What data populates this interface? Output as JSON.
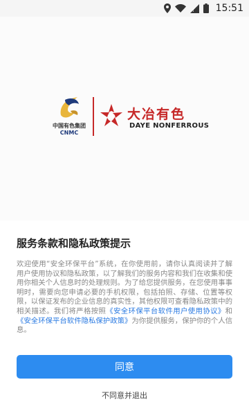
{
  "status_bar": {
    "time": "15:51",
    "icons": [
      "location-icon",
      "wifi-icon",
      "cellular-signal-icon",
      "battery-icon"
    ]
  },
  "splash": {
    "cnmc": {
      "name_cn": "中国有色集团",
      "name_en": "CNMC"
    },
    "daye": {
      "name_cn": "大冶有色",
      "name_en": "DAYE NONFERROUS"
    }
  },
  "dialog": {
    "title": "服务条款和隐私政策提示",
    "body_intro": "欢迎使用“安全环保平台”系统，在你使用前，请你认真阅读并了解用户使用协议和隐私政策，以了解我们的服务内容和我们在收集和使用你相关个人信息时的处理规则。为了给您提供服务，在您使用事事明时，需要向您申请必要的手机权限，包括拍照、存储、位置等权限，以保证发布的企业信息的真实性，其他权限可查看隐私政策中的相关描述。我们将严格按照",
    "link_user_agreement": "《安全环保平台软件用户使用协议》",
    "body_and": "和",
    "link_privacy_policy": "《安全环保平台软件隐私保护政策》",
    "body_outro": "为你提供服务，保护你的个人信息。",
    "agree_label": "同意",
    "disagree_label": "不同意并退出"
  },
  "colors": {
    "accent": "#2d8cf0",
    "link": "#2a7ae2",
    "brand_red": "#c62828",
    "cnmc_gold": "#e8b53b",
    "cnmc_blue": "#1e3a7b"
  }
}
